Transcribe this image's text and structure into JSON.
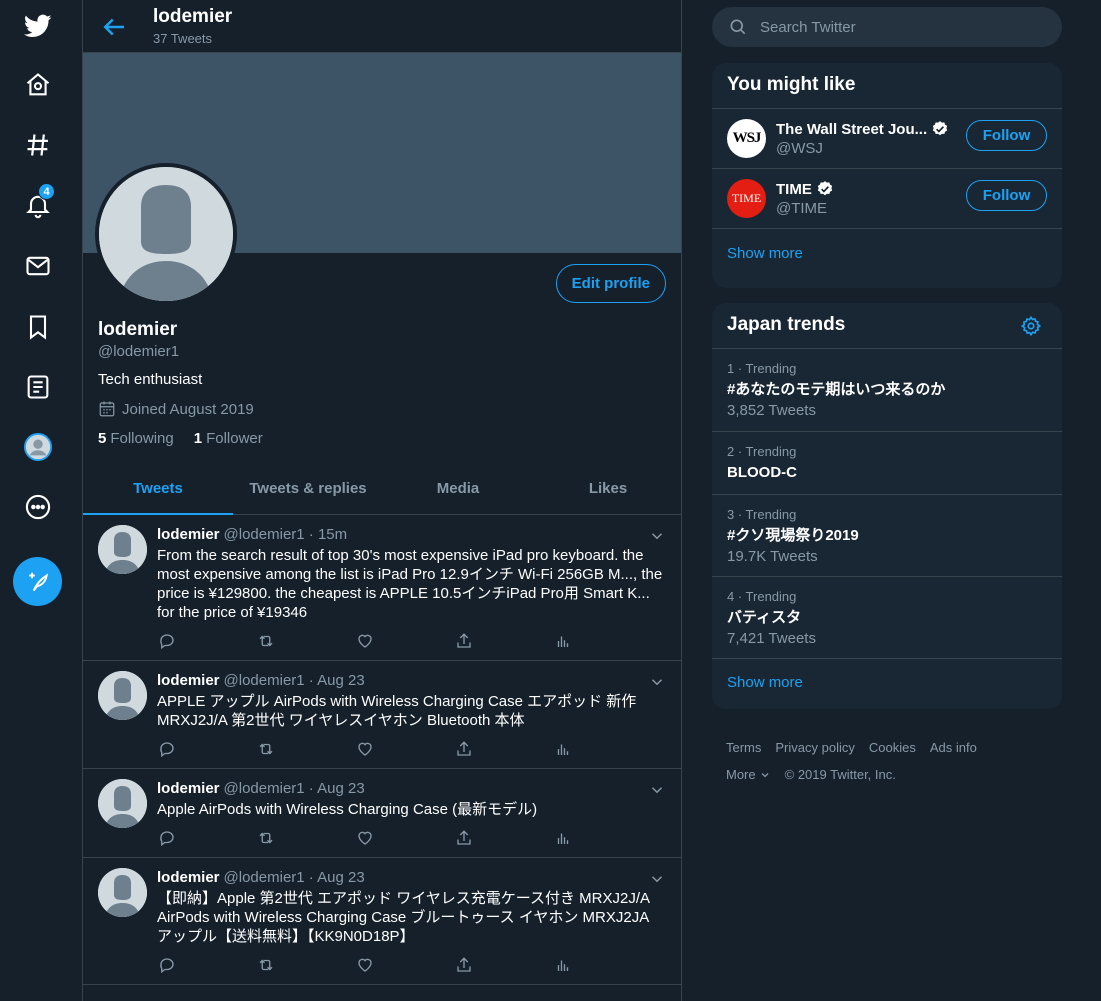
{
  "nav": {
    "items": [
      {
        "name": "twitter-logo-icon"
      },
      {
        "name": "home-icon"
      },
      {
        "name": "explore-hashtag-icon"
      },
      {
        "name": "notifications-bell-icon",
        "badge": "4"
      },
      {
        "name": "messages-envelope-icon"
      },
      {
        "name": "bookmarks-icon"
      },
      {
        "name": "lists-icon"
      },
      {
        "name": "profile-avatar-icon"
      },
      {
        "name": "more-icon"
      }
    ]
  },
  "header": {
    "name": "lodemier",
    "tweet_count": "37 Tweets"
  },
  "profile": {
    "edit_label": "Edit profile",
    "name": "lodemier",
    "handle": "@lodemier1",
    "bio": "Tech enthusiast",
    "joined": "Joined August 2019",
    "following_count": "5",
    "following_label": "Following",
    "followers_count": "1",
    "followers_label": "Follower"
  },
  "tabs": [
    "Tweets",
    "Tweets & replies",
    "Media",
    "Likes"
  ],
  "tweets": [
    {
      "name": "lodemier",
      "meta": "@lodemier1 · 15m",
      "text": "From the search result of top 30's most expensive iPad pro keyboard. the most expensive among the list is  iPad Pro 12.9インチ Wi-Fi 256GB M..., the price is ¥129800. the cheapest is APPLE 10.5インチiPad Pro用 Smart K... for the price of ¥19346"
    },
    {
      "name": "lodemier",
      "meta": "@lodemier1 · Aug 23",
      "text": "APPLE アップル AirPods with Wireless Charging Case エアポッド 新作 MRXJ2J/A 第2世代 ワイヤレスイヤホン Bluetooth 本体"
    },
    {
      "name": "lodemier",
      "meta": "@lodemier1 · Aug 23",
      "text": "Apple AirPods with Wireless Charging Case (最新モデル)"
    },
    {
      "name": "lodemier",
      "meta": "@lodemier1 · Aug 23",
      "text": "【即納】Apple 第2世代 エアポッド ワイヤレス充電ケース付き MRXJ2J/A AirPods with Wireless Charging Case ブルートゥース イヤホン MRXJ2JA アップル【送料無料】【KK9N0D18P】"
    }
  ],
  "search": {
    "placeholder": "Search Twitter"
  },
  "you_might_like": {
    "title": "You might like",
    "accounts": [
      {
        "name": "The Wall Street Jou...",
        "handle": "@WSJ",
        "logo_text": "WSJ",
        "follow": "Follow"
      },
      {
        "name": "TIME",
        "handle": "@TIME",
        "logo_text": "TIME",
        "follow": "Follow"
      }
    ],
    "show_more": "Show more"
  },
  "trends": {
    "title": "Japan trends",
    "items": [
      {
        "meta": "1 · Trending",
        "name": "#あなたのモテ期はいつ来るのか",
        "count": "3,852 Tweets"
      },
      {
        "meta": "2 · Trending",
        "name": "BLOOD-C",
        "count": ""
      },
      {
        "meta": "3 · Trending",
        "name": "#クソ現場祭り2019",
        "count": "19.7K Tweets"
      },
      {
        "meta": "4 · Trending",
        "name": "バティスタ",
        "count": "7,421 Tweets"
      }
    ],
    "show_more": "Show more"
  },
  "footer": {
    "links": [
      "Terms",
      "Privacy policy",
      "Cookies",
      "Ads info"
    ],
    "more": "More",
    "copyright": "© 2019 Twitter, Inc."
  },
  "colors": {
    "accent": "#1da1f2",
    "background": "#15202b",
    "panel": "#192734",
    "border": "#38444d",
    "muted": "#8899a6"
  }
}
